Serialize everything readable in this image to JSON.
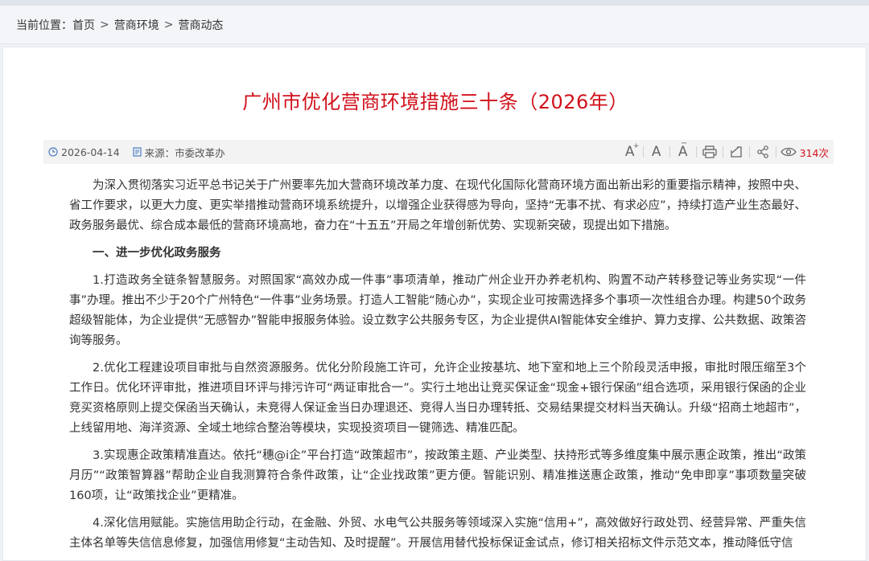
{
  "breadcrumb": {
    "label": "当前位置：",
    "items": [
      "首页",
      "营商环境",
      "营商动态"
    ],
    "separator": ">"
  },
  "article": {
    "title": "广州市优化营商环境措施三十条（2026年）",
    "date": "2026-04-14",
    "source": "来源：市委改革办",
    "views": "314次",
    "paragraphs": {
      "intro": "为深入贯彻落实习近平总书记关于广州要率先加大营商环境改革力度、在现代化国际化营商环境方面出新出彩的重要指示精神，按照中央、省工作要求，以更大力度、更实举措推动营商环境系统提升，以增强企业获得感为导向，坚持“无事不扰、有求必应”，持续打造产业生态最好、政务服务最优、综合成本最低的营商环境高地，奋力在“十五五”开局之年增创新优势、实现新突破，现提出如下措施。",
      "section1": "一、进一步优化政务服务",
      "item1": "1.打造政务全链条智慧服务。对照国家“高效办成一件事”事项清单，推动广州企业开办养老机构、购置不动产转移登记等业务实现“一件事”办理。推出不少于20个广州特色“一件事”业务场景。打造人工智能“随心办”，实现企业可按需选择多个事项一次性组合办理。构建50个政务超级智能体，为企业提供“无感智办”智能申报服务体验。设立数字公共服务专区，为企业提供AI智能体安全维护、算力支撑、公共数据、政策咨询等服务。",
      "item2": "2.优化工程建设项目审批与自然资源服务。优化分阶段施工许可，允许企业按基坑、地下室和地上三个阶段灵活申报，审批时限压缩至3个工作日。优化环评审批，推进项目环评与排污许可“两证审批合一”。实行土地出让竞买保证金“现金+银行保函”组合选项，采用银行保函的企业竞买资格原则上提交保函当天确认，未竞得人保证金当日办理退还、竞得人当日办理转抵、交易结果提交材料当天确认。升级“招商土地超市”，上线留用地、海洋资源、全域土地综合整治等模块，实现投资项目一键筛选、精准匹配。",
      "item3": "3.实现惠企政策精准直达。依托“穗@i企”平台打造“政策超市”，按政策主题、产业类型、扶持形式等多维度集中展示惠企政策，推出“政策月历”“政策智算器”帮助企业自我测算符合条件政策，让“企业找政策”更方便。智能识别、精准推送惠企政策，推动“免申即享”事项数量突破160项，让“政策找企业”更精准。",
      "item4": "4.深化信用赋能。实施信用助企行动，在金融、外贸、水电气公共服务等领域深入实施“信用+”，高效做好行政处罚、经营异常、严重失信主体名单等失信信息修复，加强信用修复“主动告知、及时提醒”。开展信用替代投标保证金试点，修订相关招标文件示范文本，推动降低守信"
    }
  },
  "toolbar": {
    "font_larger": "A",
    "font_normal": "A",
    "font_smaller": "A"
  },
  "colors": {
    "title": "#d0111b",
    "views": "#d0111b",
    "metabar_bg": "#f3f3f3",
    "icon_blue": "#4a7fc1"
  }
}
